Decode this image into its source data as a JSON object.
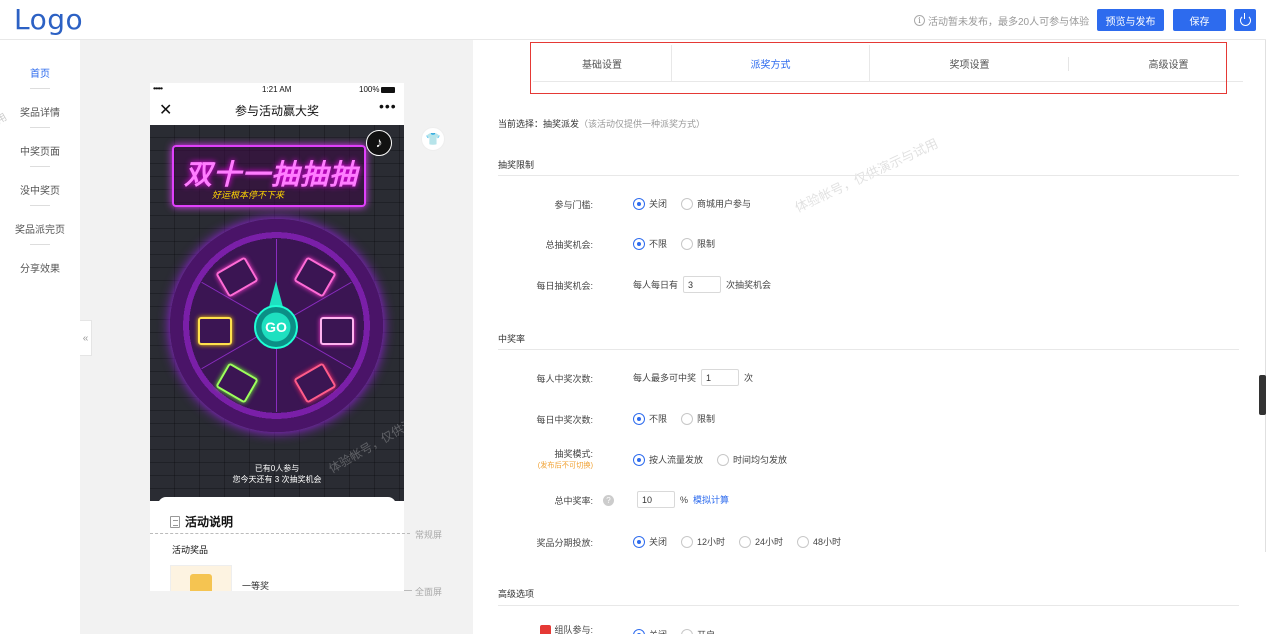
{
  "header": {
    "logo": "Logo",
    "notice": "活动暂未发布，最多20人可参与体验",
    "preview_publish_label": "预览与发布",
    "save_label": "保存"
  },
  "sidebar": {
    "items": [
      {
        "label": "首页",
        "active": true
      },
      {
        "label": "奖品详情"
      },
      {
        "label": "中奖页面"
      },
      {
        "label": "没中奖页"
      },
      {
        "label": "奖品派完页"
      },
      {
        "label": "分享效果"
      }
    ],
    "watermark_fragment": "用"
  },
  "preview": {
    "collapse_label": "«",
    "status": {
      "signal": "•••••",
      "time": "1:21 AM",
      "battery": "100%"
    },
    "nav": {
      "close": "✕",
      "title": "参与活动赢大奖",
      "more": "•••"
    },
    "banner_title": "双十一抽抽抽",
    "banner_subtitle": "好运根本停不下来",
    "go_label": "GO",
    "join_line1": "已有0人参与",
    "join_line2": "您今天还有 3 次抽奖机会",
    "watermark": "体验帐号，仅供演示与试用",
    "card": {
      "title": "活动说明",
      "sub": "活动奖品",
      "prize_name": "一等奖"
    },
    "screen_regular": "常规屏",
    "screen_full": "全面屏"
  },
  "settings": {
    "tabs": [
      {
        "label": "基础设置"
      },
      {
        "label": "派奖方式",
        "active": true
      },
      {
        "label": "奖项设置"
      },
      {
        "label": "高级设置"
      }
    ],
    "current_label": "当前选择：抽奖派发",
    "current_hint": "（该活动仅提供一种派奖方式）",
    "watermark": "体验帐号，仅供演示与试用",
    "sections": {
      "limit": "抽奖限制",
      "rate": "中奖率",
      "advanced": "高级选项"
    },
    "rows": {
      "threshold": {
        "label": "参与门槛:",
        "options": [
          "关闭",
          "商城用户参与"
        ]
      },
      "total_chances": {
        "label": "总抽奖机会:",
        "options": [
          "不限",
          "限制"
        ]
      },
      "daily_chances": {
        "label": "每日抽奖机会:",
        "prefix": "每人每日有",
        "value": "3",
        "suffix": "次抽奖机会"
      },
      "win_count": {
        "label": "每人中奖次数:",
        "prefix": "每人最多可中奖",
        "value": "1",
        "suffix": "次"
      },
      "daily_win": {
        "label": "每日中奖次数:",
        "options": [
          "不限",
          "限制"
        ]
      },
      "mode": {
        "label": "抽奖模式:",
        "note": "(发布后不可切换)",
        "options": [
          "按人流量发放",
          "时间均匀发放"
        ]
      },
      "total_rate": {
        "label": "总中奖率:",
        "help": "?",
        "value": "10",
        "unit": "%",
        "link": "模拟计算"
      },
      "staged": {
        "label": "奖品分期投放:",
        "options": [
          "关闭",
          "12小时",
          "24小时",
          "48小时"
        ]
      },
      "team": {
        "label": "组队参与:",
        "options": [
          "关闭",
          "开启"
        ]
      }
    }
  },
  "colors": {
    "accent": "#2d6bee",
    "highlight_box": "#e53935",
    "note": "#f0a030"
  }
}
